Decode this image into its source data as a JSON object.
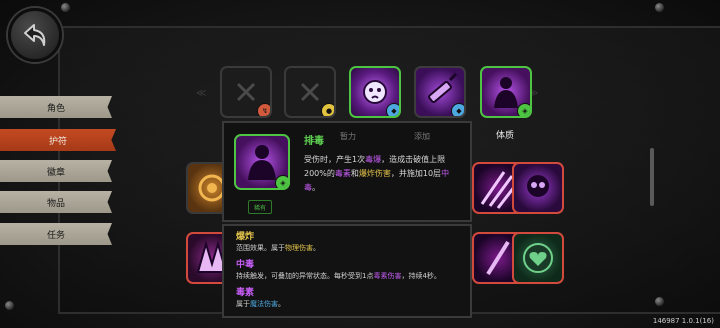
{
  "navigation": {
    "back_button_icon": "back-arrow-icon"
  },
  "sidebar": {
    "tabs": [
      {
        "label": "角色",
        "active": false
      },
      {
        "label": "护符",
        "active": true
      },
      {
        "label": "徽章",
        "active": false
      },
      {
        "label": "物品",
        "active": false
      },
      {
        "label": "任务",
        "active": false
      }
    ]
  },
  "equipped_slots": {
    "slots": [
      {
        "state": "empty",
        "icon": "x-mark-icon",
        "badge": "red-element-icon"
      },
      {
        "state": "empty",
        "icon": "x-mark-icon",
        "badge": "yellow-element-icon"
      },
      {
        "state": "filled",
        "icon": "purple-burst-face-icon",
        "badge": "blue-element-icon"
      },
      {
        "state": "filled",
        "icon": "purple-syringe-icon",
        "badge": "blue-element-icon"
      },
      {
        "state": "filled",
        "icon": "purple-figure-icon",
        "badge": "green-shield-icon"
      }
    ],
    "caption_right": "体质"
  },
  "tooltip": {
    "title": "排毒",
    "desc_line1_a": "受伤时，产生1次",
    "desc_line1_b": "毒爆",
    "desc_line1_c": "，造成击破值上限",
    "desc_line2_a": "200%的",
    "desc_line2_b": "毒素",
    "desc_line2_c": "和",
    "desc_line2_d": "爆炸伤害",
    "desc_line2_e": "，并施加10层",
    "desc_line2_f": "中毒",
    "desc_line2_g": "。",
    "tag": "稀有",
    "ghost_labels": [
      "暂力",
      "添加"
    ]
  },
  "keywords": [
    {
      "title": "爆炸",
      "desc_a": "范围效果。属于",
      "desc_b": "物理伤害",
      "desc_c": "。"
    },
    {
      "title": "中毒",
      "desc_a": "持续触发，可叠加的异常状态。每秒受到1点",
      "desc_b": "毒素伤害",
      "desc_c": "，持续4秒。"
    },
    {
      "title": "毒素",
      "desc_a": "属于",
      "desc_b": "魔法伤害",
      "desc_c": "。"
    }
  ],
  "version": "146987 1.0.1(16)",
  "colors": {
    "accent_green": "#4ec443",
    "accent_purple": "#c35cf2",
    "tab_active": "#b8441e",
    "slot_red": "#d24a3c"
  }
}
